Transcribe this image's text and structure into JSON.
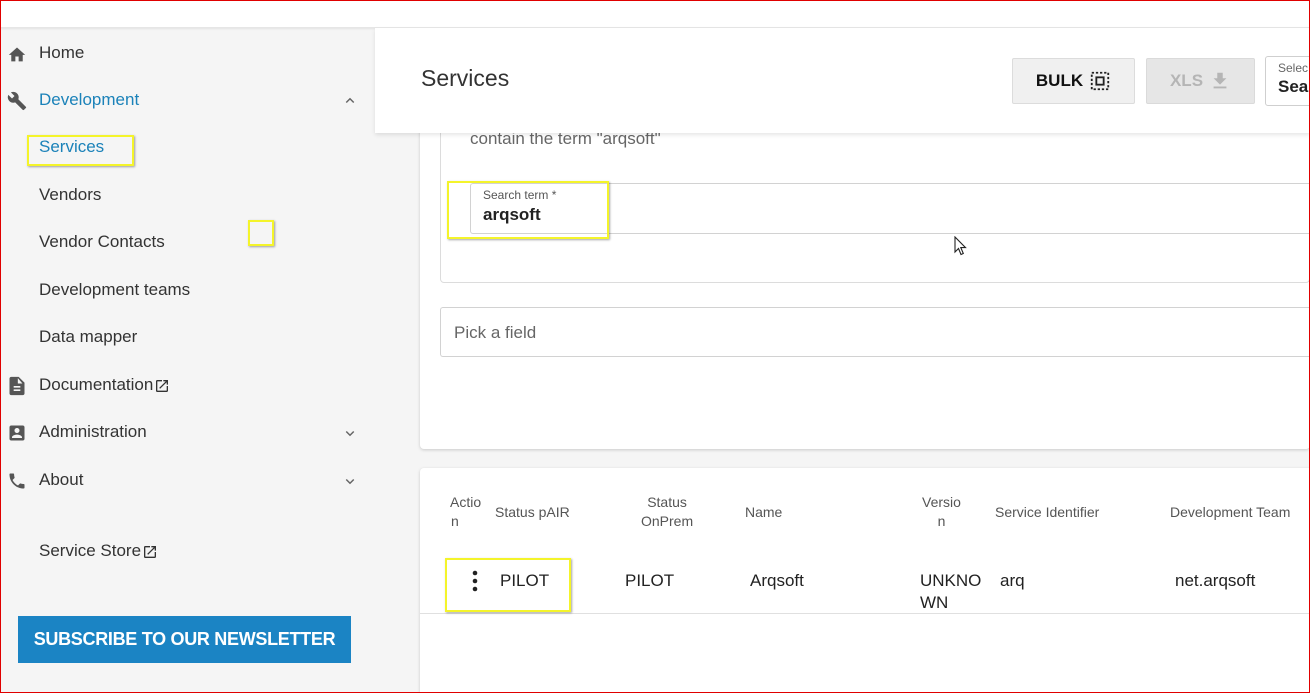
{
  "sidebar": {
    "items": [
      {
        "label": "Home",
        "icon": "home-icon"
      },
      {
        "label": "Development",
        "icon": "wrench-icon",
        "expanded": true,
        "accent": "#1b82b9"
      },
      {
        "label": "Services",
        "active": true
      },
      {
        "label": "Vendors"
      },
      {
        "label": "Vendor Contacts"
      },
      {
        "label": "Development teams"
      },
      {
        "label": "Data mapper"
      },
      {
        "label": "Documentation",
        "icon": "document-icon",
        "external": true
      },
      {
        "label": "Administration",
        "icon": "account-box-icon"
      },
      {
        "label": "About",
        "icon": "phone-icon"
      },
      {
        "label": "Service Store",
        "external": true
      }
    ],
    "subscribe_label": "SUBSCRIBE TO OUR NEWSLETTER"
  },
  "header": {
    "title": "Services",
    "bulk_label": "BULK",
    "xls_label": "XLS",
    "select_label": "Selec",
    "select_value": "Sea"
  },
  "search": {
    "help_text": "contain the term \"arqsoft\"",
    "field_label": "Search term *",
    "field_value": "arqsoft",
    "pick_placeholder": "Pick a field"
  },
  "table": {
    "headers": {
      "action": [
        "Actio",
        "n"
      ],
      "status_pair": "Status pAIR",
      "status_onprem": [
        "Status",
        "OnPrem"
      ],
      "name": "Name",
      "version": [
        "Versio",
        "n"
      ],
      "service_identifier": "Service Identifier",
      "development_team": "Development Team"
    },
    "rows": [
      {
        "status_pair": "PILOT",
        "status_onprem": "PILOT",
        "name": "Arqsoft",
        "version": [
          "UNKNO",
          "WN"
        ],
        "service_identifier": "arq",
        "development_team": "net.arqsoft"
      }
    ]
  },
  "colors": {
    "accent": "#1b82b9",
    "subscribe_bg": "#1b84c4",
    "highlight": "#f4f42a",
    "frame": "#e00000"
  }
}
